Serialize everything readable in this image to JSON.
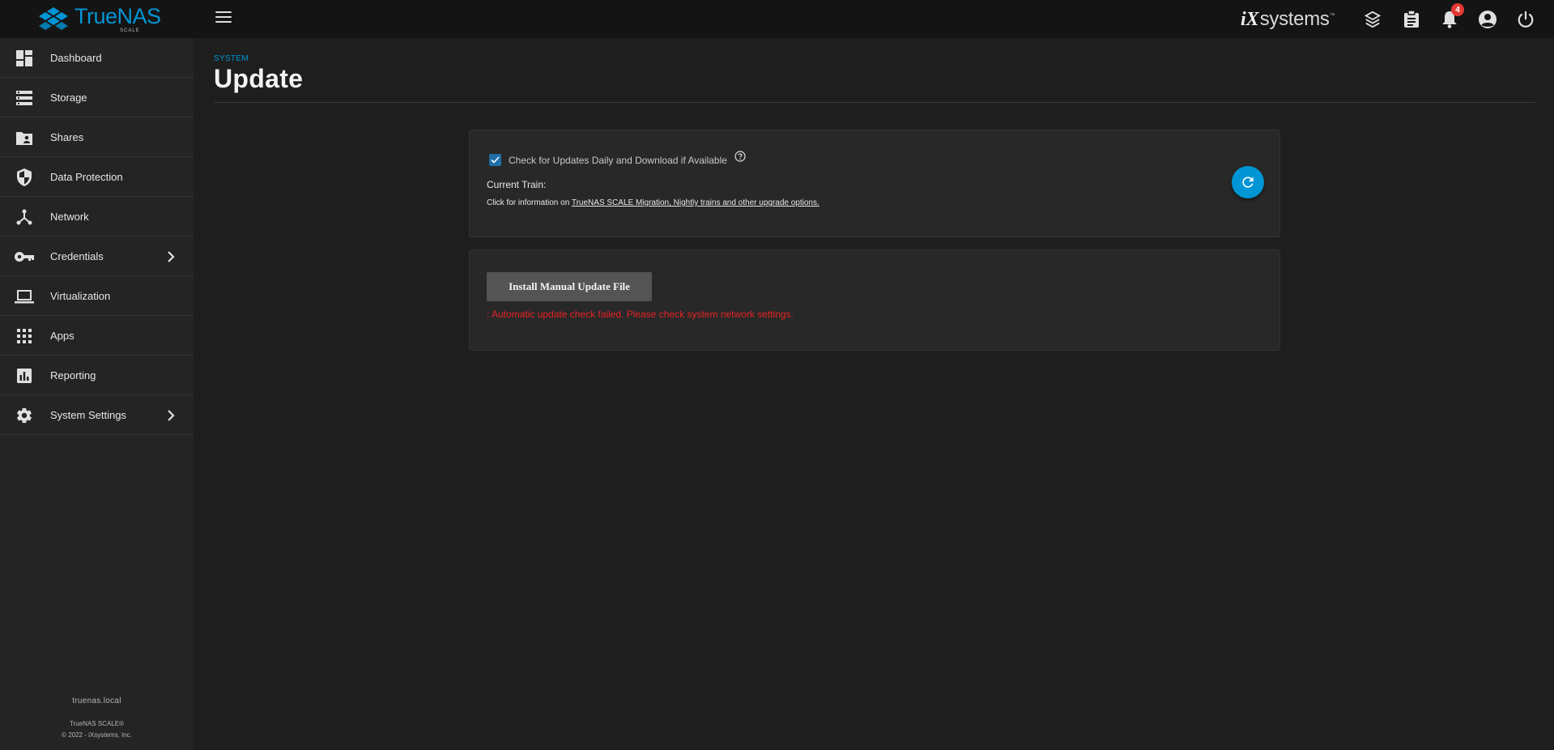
{
  "topbar": {
    "brand_name": "TrueNAS",
    "brand_sub": "SCALE",
    "vendor_prefix": "iX",
    "vendor_suffix": "systems",
    "vendor_mark": "™",
    "notification_count": "4",
    "icons": [
      "menu-icon",
      "truecommand-icon",
      "clipboard-icon",
      "bell-icon",
      "account-icon",
      "power-icon"
    ]
  },
  "sidebar": {
    "items": [
      {
        "label": "Dashboard",
        "icon": "dashboard-icon"
      },
      {
        "label": "Storage",
        "icon": "storage-icon"
      },
      {
        "label": "Shares",
        "icon": "shares-icon"
      },
      {
        "label": "Data Protection",
        "icon": "shield-icon"
      },
      {
        "label": "Network",
        "icon": "network-icon"
      },
      {
        "label": "Credentials",
        "icon": "key-icon"
      },
      {
        "label": "Virtualization",
        "icon": "laptop-icon"
      },
      {
        "label": "Apps",
        "icon": "apps-grid-icon"
      },
      {
        "label": "Reporting",
        "icon": "chart-icon"
      },
      {
        "label": "System Settings",
        "icon": "gear-icon"
      }
    ],
    "hostname": "truenas.local",
    "product": "TrueNAS SCALE®",
    "copyright": "© 2022 - iXsystems, Inc."
  },
  "page": {
    "breadcrumb": "SYSTEM",
    "title": "Update"
  },
  "update_card": {
    "auto_check_label": "Check for Updates Daily and Download if Available",
    "auto_check_checked": true,
    "current_train_label": "Current Train:",
    "info_prefix": "Click for information on ",
    "info_link": "TrueNAS SCALE Migration, Nightly trains and other upgrade options."
  },
  "manual_card": {
    "button_label": "Install Manual Update File",
    "error_message": ": Automatic update check failed. Please check system network settings."
  },
  "colors": {
    "accent": "#0095d5",
    "error": "#e82222",
    "badge": "#e53935"
  }
}
